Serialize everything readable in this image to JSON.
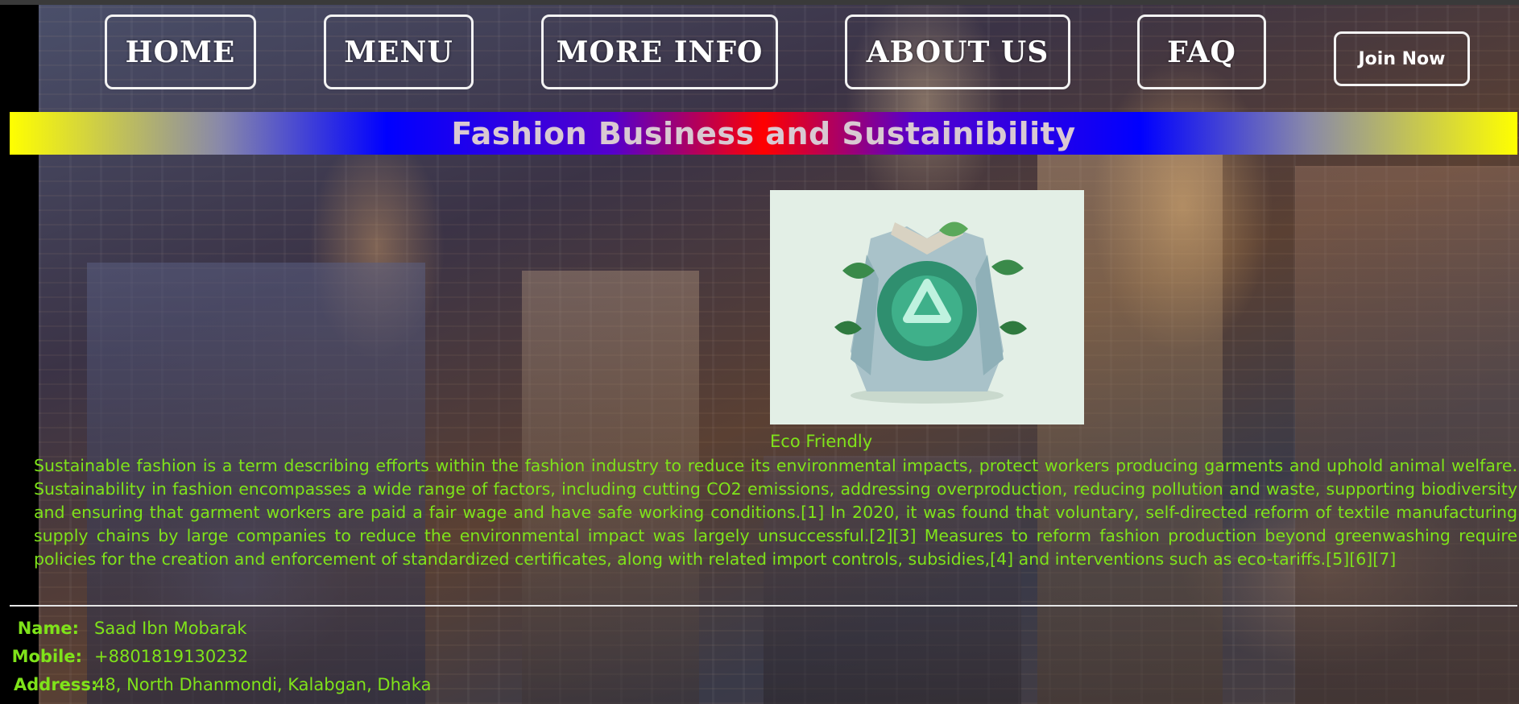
{
  "nav": {
    "items": [
      {
        "label": "HOME"
      },
      {
        "label": "MENU"
      },
      {
        "label": "MORE INFO"
      },
      {
        "label": "ABOUT US"
      },
      {
        "label": "FAQ"
      }
    ],
    "join_label": "Join Now"
  },
  "banner": {
    "title": "Fashion Business and Sustainibility"
  },
  "figure": {
    "caption": "Eco Friendly",
    "icon": "recycle-jacket-image"
  },
  "article": {
    "text": "Sustainable fashion is a term describing efforts within the fashion industry to reduce its environmental impacts, protect workers producing garments and uphold animal welfare. Sustainability in fashion encompasses a wide range of factors, including cutting CO2 emissions, addressing overproduction, reducing pollution and waste, supporting biodiversity and ensuring that garment workers are paid a fair wage and have safe working conditions.[1] In 2020, it was found that voluntary, self-directed reform of textile manufacturing supply chains by large companies to reduce the environmental impact was largely unsuccessful.[2][3] Measures to reform fashion production beyond greenwashing require policies for the creation and enforcement of standardized certificates, along with related import controls, subsidies,[4] and interventions such as eco-tariffs.[5][6][7]"
  },
  "contact": {
    "name_label": "Name:",
    "name_value": "Saad Ibn Mobarak",
    "mobile_label": "Mobile:",
    "mobile_value": "+8801819130232",
    "address_label": "Address:",
    "address_value": "48, North Dhanmondi, Kalabgan, Dhaka"
  },
  "colors": {
    "text_accent": "#7fe31a",
    "banner_title": "#d9c9d2",
    "nav_border": "#f3f3f3"
  }
}
